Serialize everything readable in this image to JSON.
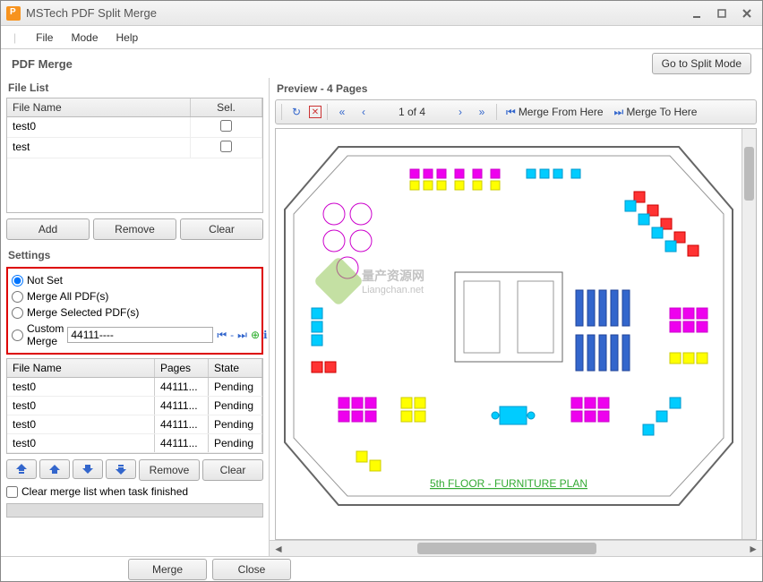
{
  "titlebar": {
    "title": "MSTech PDF Split Merge"
  },
  "menu": {
    "file": "File",
    "mode": "Mode",
    "help": "Help"
  },
  "header": {
    "title": "PDF Merge",
    "split_mode": "Go to Split Mode"
  },
  "file_list": {
    "label": "File List",
    "col_name": "File Name",
    "col_sel": "Sel.",
    "rows": [
      {
        "name": "test0"
      },
      {
        "name": "test"
      }
    ],
    "add": "Add",
    "remove": "Remove",
    "clear": "Clear"
  },
  "settings": {
    "label": "Settings",
    "not_set": "Not Set",
    "merge_all": "Merge All PDF(s)",
    "merge_sel": "Merge Selected PDF(s)",
    "custom": "Custom Merge",
    "custom_value": "44111----"
  },
  "merge_list": {
    "col_name": "File Name",
    "col_pages": "Pages",
    "col_state": "State",
    "rows": [
      {
        "name": "test0",
        "pages": "44111...",
        "state": "Pending"
      },
      {
        "name": "test0",
        "pages": "44111...",
        "state": "Pending"
      },
      {
        "name": "test0",
        "pages": "44111...",
        "state": "Pending"
      },
      {
        "name": "test0",
        "pages": "44111...",
        "state": "Pending"
      }
    ],
    "remove": "Remove",
    "clear": "Clear",
    "clear_check": "Clear merge list when task finished"
  },
  "bottom": {
    "merge": "Merge",
    "close": "Close"
  },
  "preview": {
    "title": "Preview - 4 Pages",
    "page_indicator": "1 of 4",
    "merge_from": "Merge From Here",
    "merge_to": "Merge To Here"
  },
  "watermark": {
    "text1": "量产资源网",
    "text2": "Liangchan.net"
  },
  "floorplan_label": "5th FLOOR - FURNITURE PLAN"
}
